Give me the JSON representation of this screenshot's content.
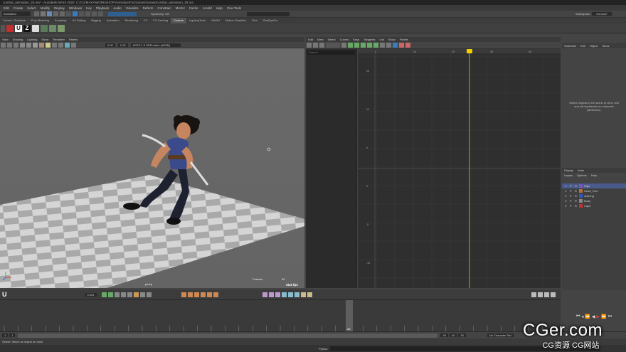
{
  "window": {
    "title": "Autodesk MAYA 2020: C:\\CGM\\ONLINE\\WORKSHOP\\Animation\\ForGames\\scenes\\combat_animation_20.ma*",
    "title_short": "combat_animation_20.ma* - Autodesk MAYA 2020: C:/CG/MAYA/WORKSHOP/AnimationForGames/scenes/combat_animation_29.ma",
    "workspace_label": "Workspace:",
    "workspace_value": "General*"
  },
  "menubar": [
    "Edit",
    "Create",
    "Select",
    "Modify",
    "Display",
    "Windows",
    "Key",
    "Playback",
    "Audio",
    "Visualize",
    "Deform",
    "Constrain",
    "MASH",
    "Cache",
    "Arnold",
    "Help",
    "Ziva Tools"
  ],
  "status": {
    "mode": "Animation",
    "symmetry": "Symmetry: Off"
  },
  "shelf_tabs": [
    {
      "label": "Curves / Surfaces",
      "active": false
    },
    {
      "label": "Poly Modeling",
      "active": false
    },
    {
      "label": "Sculpting",
      "active": false
    },
    {
      "label": "UV Editing",
      "active": false
    },
    {
      "label": "Rigging",
      "active": false
    },
    {
      "label": "Animation",
      "active": false
    },
    {
      "label": "Rendering",
      "active": false
    },
    {
      "label": "FX",
      "active": false
    },
    {
      "label": "FX Caching",
      "active": false
    },
    {
      "label": "Custom",
      "active": true
    },
    {
      "label": "LightingTools",
      "active": false
    },
    {
      "label": "MASH",
      "active": false
    },
    {
      "label": "Motion Graphics",
      "active": false
    },
    {
      "label": "Ziva",
      "active": false
    },
    {
      "label": "ZivaDynPro",
      "active": false
    }
  ],
  "viewport": {
    "menu": [
      "View",
      "Shading",
      "Lighting",
      "Show",
      "Renderer",
      "Panels"
    ],
    "colorspace": "ACES 1.0 SDR-video (sRGB)",
    "exposure": "0.00",
    "gamma": "1.00",
    "camera_label": "persp",
    "frames_label": "Frames:",
    "frames_value": "30",
    "fps": "28.8 fps"
  },
  "graph_editor": {
    "menu": [
      "Edit",
      "View",
      "Select",
      "Curves",
      "Keys",
      "Tangents",
      "List",
      "Show",
      "Panels"
    ],
    "search_placeholder": "Search...",
    "frame_ticks": [
      "0",
      "10",
      "20",
      "30",
      "40"
    ],
    "value_ticks": [
      "15",
      "10",
      "5",
      "0",
      "-5",
      "-10",
      "-15"
    ]
  },
  "channel_box": {
    "menu": [
      "Channels",
      "Edit",
      "Object",
      "Show"
    ],
    "message": "Select objects in the scene to view, edit and set keyframes on channels (attributes)."
  },
  "layers": {
    "tabs": [
      "Display",
      "Anim"
    ],
    "menu": [
      "Layers",
      "Options",
      "Help"
    ],
    "items": [
      {
        "name": "Rigs",
        "color": "#7a55b8",
        "highlight": true
      },
      {
        "name": "Head_Geo",
        "color": "#b8703a",
        "highlight": false
      },
      {
        "name": "clothing",
        "color": "#2e56c8",
        "highlight": false
      },
      {
        "name": "Body",
        "color": "#8a8a8a",
        "highlight": false
      },
      {
        "name": "Cape",
        "color": "#c83030",
        "highlight": false
      }
    ]
  },
  "timeline": {
    "current_frame": "26",
    "range_start": "1",
    "range_end": "40",
    "anim_start": "1",
    "anim_end": "40",
    "fps_field": "30",
    "character_set": "No Character Set",
    "playback_frame": "0.001"
  },
  "help_line": "Select: Select an object to move.",
  "command_label": "Python",
  "watermark": {
    "main": "CGer.com",
    "sub": "CG资源 CG网站"
  }
}
